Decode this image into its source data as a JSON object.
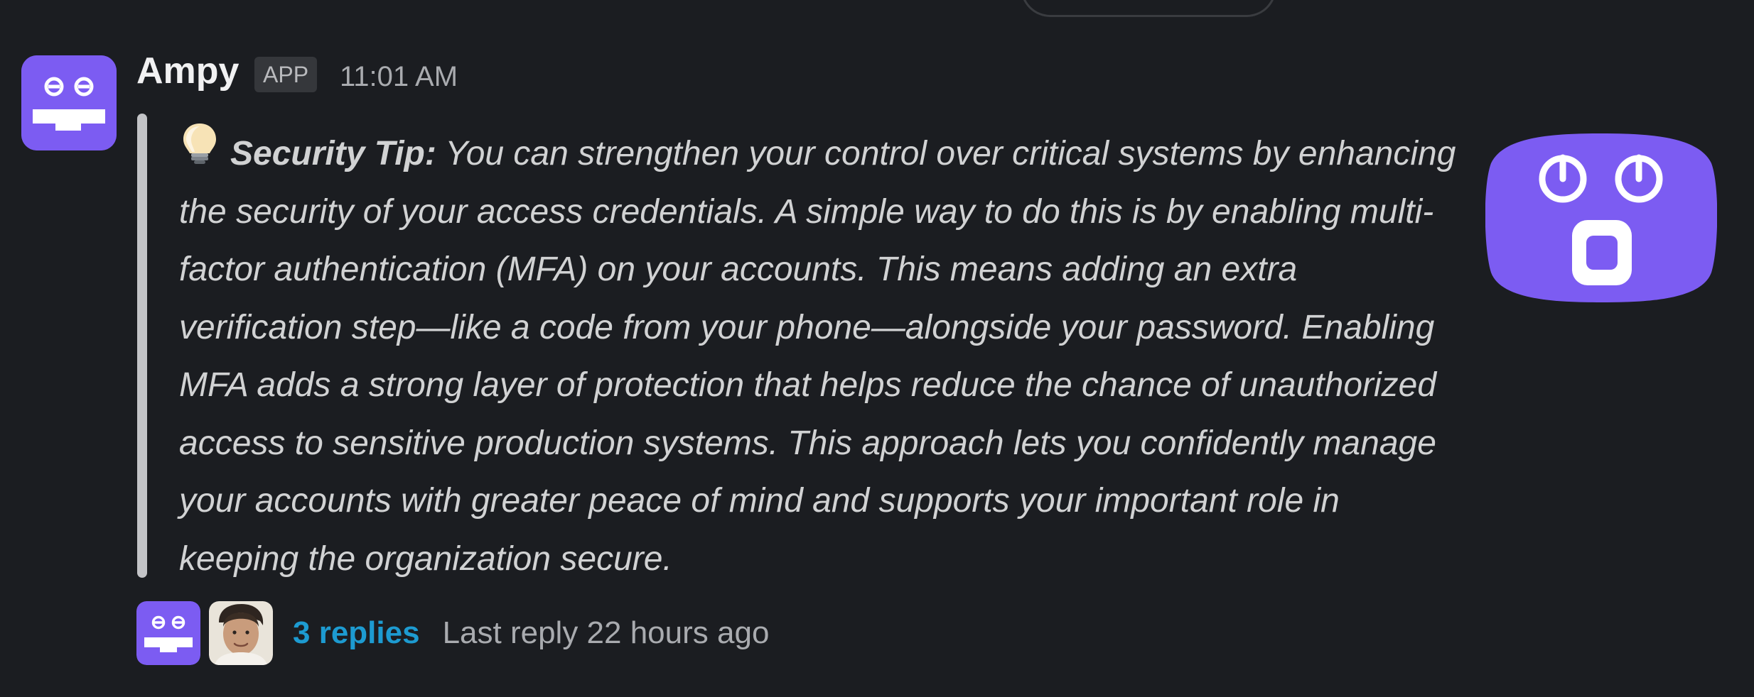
{
  "message": {
    "author": "Ampy",
    "badge": "APP",
    "time": "11:01 AM",
    "tip_label": "Security Tip:",
    "tip_body": " You can strengthen your control over critical systems by enhancing the security of your access credentials. A simple way to do this is by enabling multi-factor authentication (MFA) on your accounts. This means adding an extra verification step—like a code from your phone—alongside your password. Enabling MFA adds a strong layer of protection that helps reduce the chance of unauthorized access to sensitive production systems. This approach lets you confidently manage your accounts with greater peace of mind and supports your important role in keeping the organization secure."
  },
  "thread": {
    "replies_label": "3 replies",
    "last_reply": "Last reply 22 hours ago"
  },
  "icons": {
    "avatar": "robot-face-icon",
    "tip": "light-bulb-icon",
    "attachment": "surprised-robot-image"
  },
  "colors": {
    "background": "#1b1d21",
    "accent_purple": "#7c5cf2",
    "link": "#1d9bd1"
  }
}
